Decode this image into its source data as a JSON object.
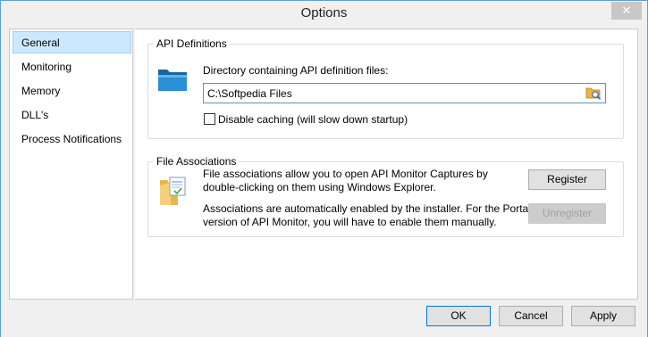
{
  "window": {
    "title": "Options",
    "close_glyph": "✕"
  },
  "sidebar": {
    "items": [
      {
        "label": "General",
        "selected": true
      },
      {
        "label": "Monitoring",
        "selected": false
      },
      {
        "label": "Memory",
        "selected": false
      },
      {
        "label": "DLL's",
        "selected": false
      },
      {
        "label": "Process Notifications",
        "selected": false
      }
    ]
  },
  "api_definitions": {
    "group_label": "API Definitions",
    "directory_label": "Directory containing API definition files:",
    "directory_value": "C:\\Softpedia Files",
    "browse_icon": "folder-browse-icon",
    "disable_caching_label": "Disable caching (will slow down startup)",
    "disable_caching_checked": false
  },
  "file_associations": {
    "group_label": "File Associations",
    "description_line1": "File associations allow you to open API Monitor Captures by",
    "description_line2": "double-clicking on them using Windows Explorer.",
    "auto_line1": "Associations are automatically enabled by the installer. For the Portable",
    "auto_line2": "version of API Monitor, you will have to enable them manually.",
    "register_label": "Register",
    "unregister_label": "Unregister",
    "unregister_enabled": false
  },
  "footer": {
    "ok_label": "OK",
    "cancel_label": "Cancel",
    "apply_label": "Apply"
  },
  "colors": {
    "accent": "#0078d7",
    "selection_bg": "#cce8ff",
    "folder_blue": "#1e7fc0"
  }
}
